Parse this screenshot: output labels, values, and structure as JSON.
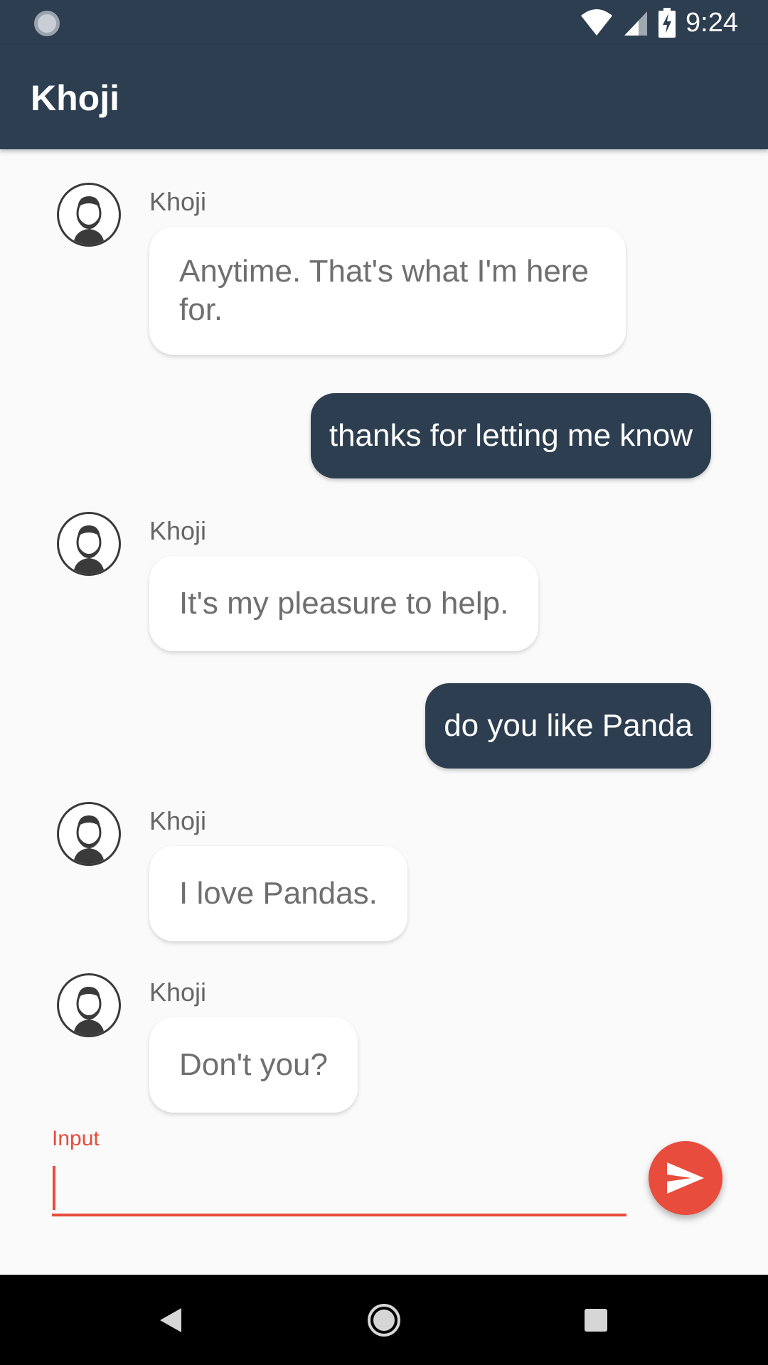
{
  "status_bar": {
    "time": "9:24",
    "icons": [
      "loading-icon",
      "wifi-icon",
      "signal-icon",
      "battery-charging-icon"
    ]
  },
  "app_bar": {
    "title": "Khoji"
  },
  "messages": [
    {
      "type": "bot",
      "sender": "Khoji",
      "text": "Anytime. That's what I'm here for."
    },
    {
      "type": "user",
      "text": "thanks for letting me know"
    },
    {
      "type": "bot",
      "sender": "Khoji",
      "text": "It's my pleasure to help."
    },
    {
      "type": "user",
      "text": "do you like Panda"
    },
    {
      "type": "bot",
      "sender": "Khoji",
      "text": "I love Pandas."
    },
    {
      "type": "bot",
      "sender": "Khoji",
      "text": "Don't you?"
    }
  ],
  "input": {
    "label": "Input",
    "value": "",
    "placeholder": ""
  },
  "send_button": {
    "icon": "send-icon"
  },
  "nav_bar": {
    "buttons": [
      "back-icon",
      "home-icon",
      "recents-icon"
    ]
  },
  "colors": {
    "primary": "#2d3e50",
    "accent": "#e74c3c",
    "background": "#fafafa",
    "bot_bubble": "#ffffff",
    "bot_text": "#6f6f6f"
  }
}
